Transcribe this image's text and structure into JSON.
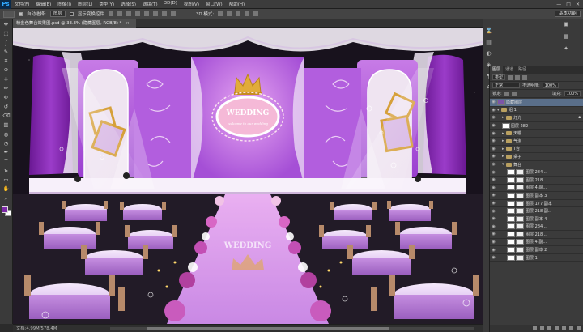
{
  "app": {
    "logo": "Ps"
  },
  "menu": [
    "文件(F)",
    "编辑(E)",
    "图像(I)",
    "图层(L)",
    "类型(Y)",
    "选择(S)",
    "滤镜(T)",
    "3D(D)",
    "视图(V)",
    "窗口(W)",
    "帮助(H)"
  ],
  "window_controls": [
    "—",
    "□",
    "✕"
  ],
  "options": {
    "auto_select_label": "自动选择:",
    "auto_select_value": "图层",
    "show_transform_label": "显示变换控件",
    "mode_label": "3D 模式:",
    "workspace": "基本功能"
  },
  "document": {
    "tab_title": "粉金色舞台效果图.psd @ 33.3% (隐藏图层, RGB/8) *",
    "close": "×"
  },
  "status": {
    "text": "文档:4.99M/578.4M"
  },
  "colors": {
    "foreground": "#7d2aa8",
    "background": "#ffffff"
  },
  "canvas": {
    "backdrop_text": "WEDDING",
    "backdrop_subtitle": "welcome to our wedding",
    "aisle_text": "WEDDING"
  },
  "tools": [
    "move-icon",
    "marquee-icon",
    "lasso-icon",
    "quick-select-icon",
    "crop-icon",
    "eyedropper-icon",
    "heal-icon",
    "brush-icon",
    "stamp-icon",
    "history-brush-icon",
    "eraser-icon",
    "gradient-icon",
    "blur-icon",
    "dodge-icon",
    "pen-icon",
    "type-icon",
    "path-select-icon",
    "shape-icon",
    "hand-icon",
    "zoom-icon"
  ],
  "layers_panel": {
    "tabs": [
      "图层",
      "通道",
      "路径"
    ],
    "kind_label": "类型",
    "mode": "正常",
    "opacity_label": "不透明度:",
    "opacity": "100%",
    "lock_label": "锁定:",
    "fill_label": "填充:",
    "fill": "100%",
    "layers": [
      {
        "name": "隐藏图层",
        "indent": 0,
        "group": false,
        "selected": true,
        "expanded": false
      },
      {
        "name": "组 1",
        "indent": 0,
        "group": true,
        "selected": false,
        "expanded": true
      },
      {
        "name": "灯光",
        "indent": 1,
        "group": true,
        "selected": false,
        "expanded": false,
        "locked": true
      },
      {
        "name": "图层 282",
        "indent": 1,
        "group": false,
        "selected": false,
        "expanded": false
      },
      {
        "name": "天幔",
        "indent": 1,
        "group": true,
        "selected": false,
        "expanded": false
      },
      {
        "name": "气泡",
        "indent": 1,
        "group": true,
        "selected": false,
        "expanded": false
      },
      {
        "name": "T台",
        "indent": 1,
        "group": true,
        "selected": false,
        "expanded": false
      },
      {
        "name": "桌子",
        "indent": 1,
        "group": true,
        "selected": false,
        "expanded": false
      },
      {
        "name": "舞台",
        "indent": 1,
        "group": true,
        "selected": false,
        "expanded": true
      },
      {
        "name": "图层 284 ...",
        "indent": 2,
        "group": false,
        "selected": false,
        "expanded": false
      },
      {
        "name": "图层 218 ...",
        "indent": 2,
        "group": false,
        "selected": false,
        "expanded": false
      },
      {
        "name": "图层 4 副...",
        "indent": 2,
        "group": false,
        "selected": false,
        "expanded": false
      },
      {
        "name": "图层 副本 3",
        "indent": 2,
        "group": false,
        "selected": false,
        "expanded": false
      },
      {
        "name": "图层 177 副本",
        "indent": 2,
        "group": false,
        "selected": false,
        "expanded": false
      },
      {
        "name": "图层 218 副...",
        "indent": 2,
        "group": false,
        "selected": false,
        "expanded": false
      },
      {
        "name": "图层 副本 4",
        "indent": 2,
        "group": false,
        "selected": false,
        "expanded": false
      },
      {
        "name": "图层 284 ...",
        "indent": 2,
        "group": false,
        "selected": false,
        "expanded": false
      },
      {
        "name": "图层 218 ...",
        "indent": 2,
        "group": false,
        "selected": false,
        "expanded": false
      },
      {
        "name": "图层 4 副...",
        "indent": 2,
        "group": false,
        "selected": false,
        "expanded": false
      },
      {
        "name": "图层 副本 2",
        "indent": 2,
        "group": false,
        "selected": false,
        "expanded": false
      },
      {
        "name": "图层 1",
        "indent": 2,
        "group": false,
        "selected": false,
        "expanded": false
      }
    ]
  }
}
